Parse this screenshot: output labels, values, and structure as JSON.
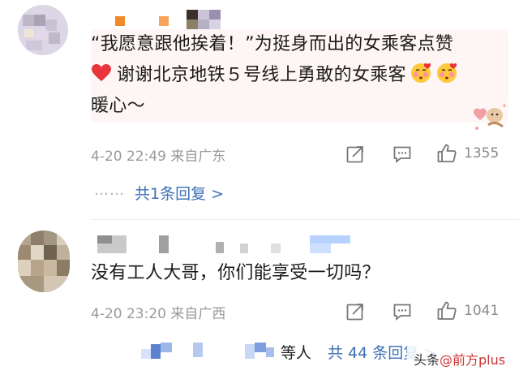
{
  "comment1": {
    "text_line1": "“我愿意跟他挨着！”为挺身而出的女乘客点赞",
    "text_line2": "谢谢北京地铁５号线上勇敢的女乘客",
    "text_line3": "暖心～",
    "time": "4-20 22:49 来自广东",
    "like_count": "1355",
    "reply_dots": "……",
    "reply_summary": "共1条回复 >"
  },
  "comment2": {
    "text": "没有工人大哥，你们能享受一切吗？",
    "time": "4-20 23:20 来自广西",
    "like_count": "1041",
    "reply_suffix": "等人",
    "reply_summary": "共 44 条回复 >"
  },
  "icons": {
    "share": "share-icon",
    "comment": "comment-icon",
    "like": "thumbs-up-icon",
    "heart": "red-heart-emoji",
    "kiss": "kissing-heart-emoji"
  },
  "watermark": {
    "prefix": "头条",
    "handle": "@前方plus"
  },
  "colors": {
    "link": "#3d6fb6",
    "meta": "#9a9a9a",
    "bubble": "#fdf6f4",
    "heart": "#e8343b"
  }
}
